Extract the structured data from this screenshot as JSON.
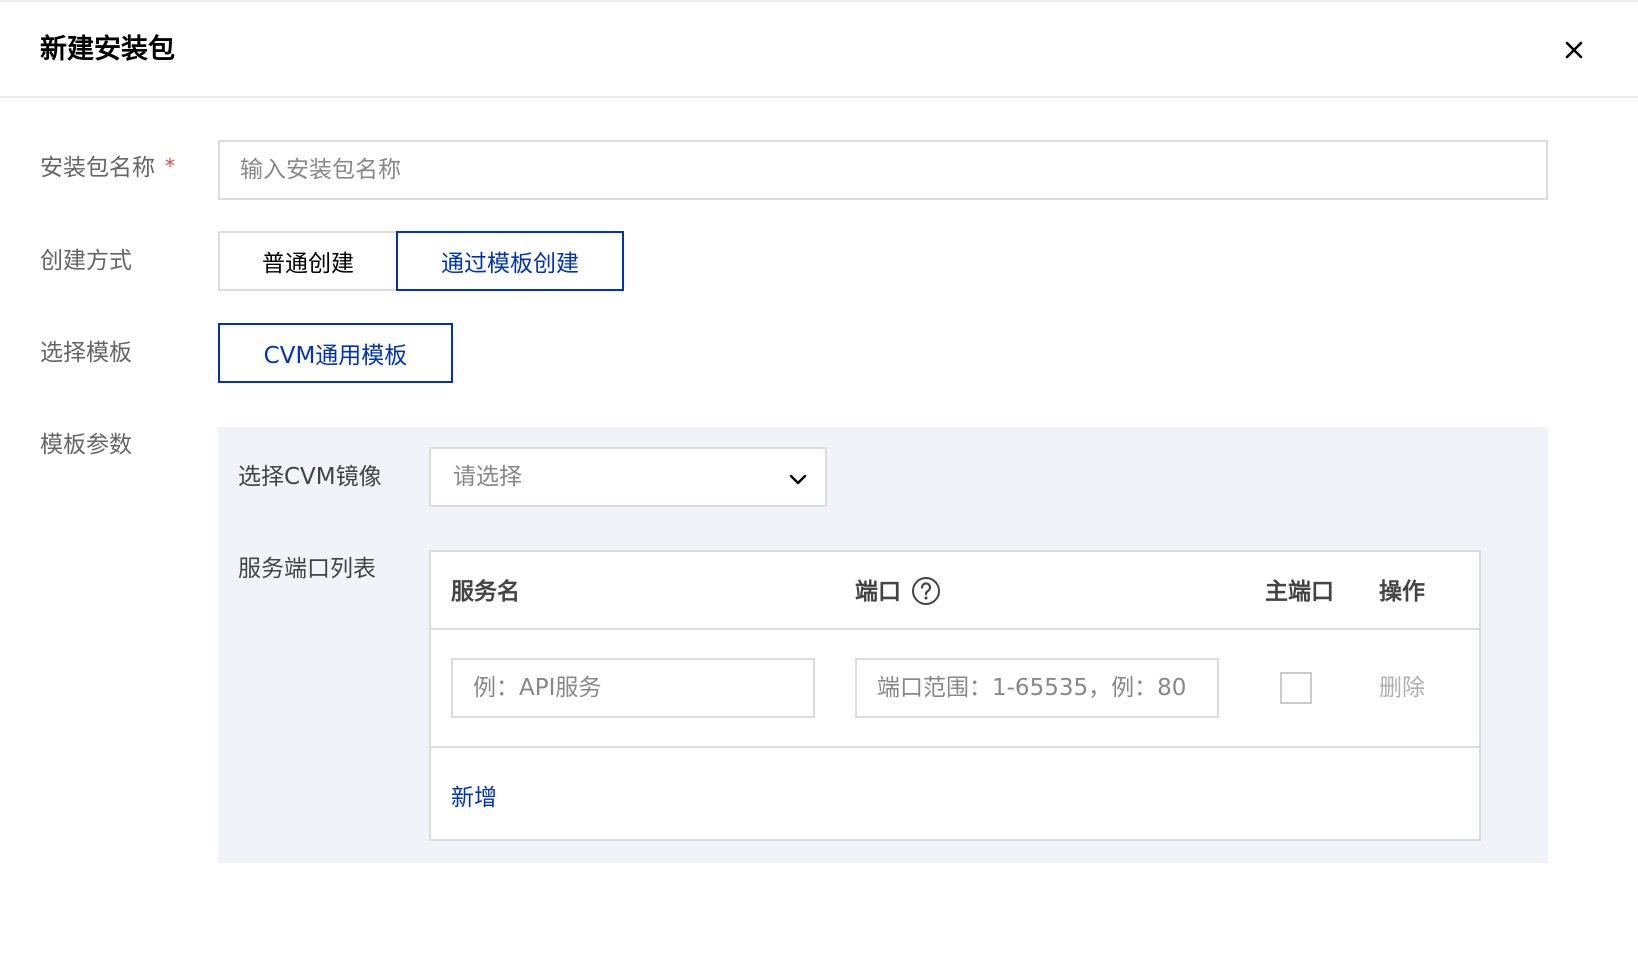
{
  "dialog": {
    "title": "新建安装包"
  },
  "form": {
    "package_name": {
      "label": "安装包名称",
      "required_mark": "*",
      "placeholder": "输入安装包名称",
      "value": ""
    },
    "create_mode": {
      "label": "创建方式",
      "options": [
        "普通创建",
        "通过模板创建"
      ],
      "selected": "通过模板创建"
    },
    "template": {
      "label": "选择模板",
      "selected": "CVM通用模板"
    },
    "template_params": {
      "label": "模板参数",
      "cvm_image": {
        "label": "选择CVM镜像",
        "placeholder": "请选择"
      },
      "service_ports": {
        "label": "服务端口列表",
        "columns": [
          "服务名",
          "端口",
          "主端口",
          "操作"
        ],
        "rows": [
          {
            "service_placeholder": "例：API服务",
            "port_placeholder": "端口范围：1-65535，例：80",
            "primary": false,
            "action": "删除"
          }
        ],
        "add_label": "新增"
      }
    }
  },
  "colors": {
    "accent": "#0034b4",
    "required": "#e54545",
    "border": "#dcdcdc",
    "panel_bg": "#f2f3f8"
  },
  "icons": {
    "close": "close-icon",
    "help": "help-circle-icon",
    "dropdown": "chevron-down-icon"
  }
}
